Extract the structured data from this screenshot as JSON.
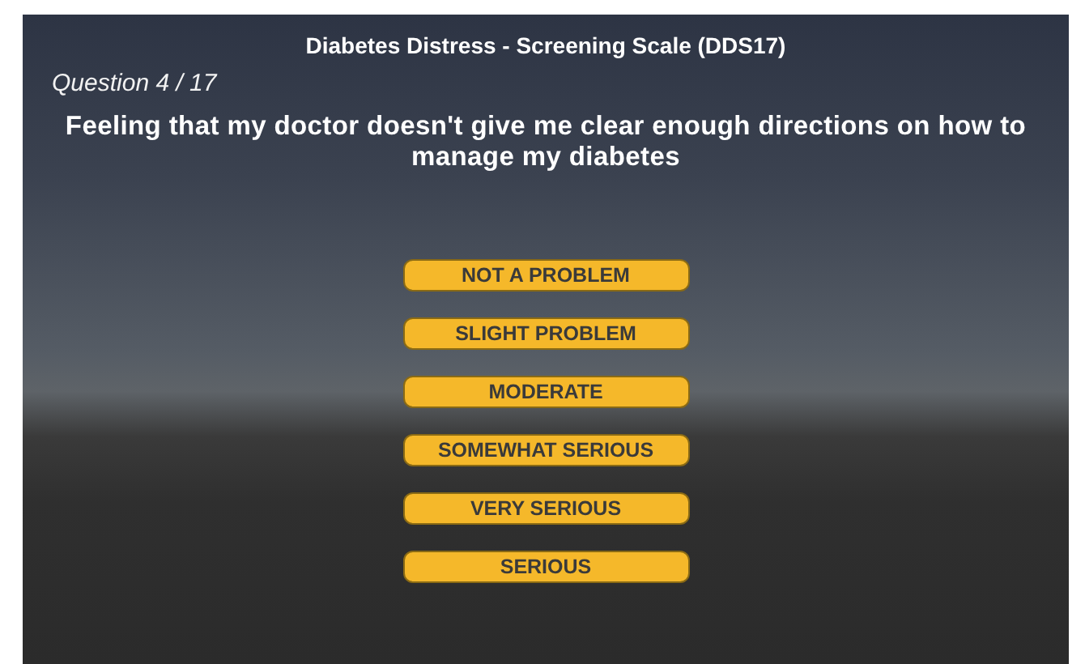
{
  "title": "Diabetes Distress - Screening Scale (DDS17)",
  "progress": "Question 4 / 17",
  "question": "Feeling that my doctor doesn't give me clear enough directions on how to manage my diabetes",
  "answers": [
    {
      "label": "NOT A PROBLEM"
    },
    {
      "label": "SLIGHT PROBLEM"
    },
    {
      "label": "MODERATE"
    },
    {
      "label": "SOMEWHAT SERIOUS"
    },
    {
      "label": "VERY SERIOUS"
    },
    {
      "label": "SERIOUS"
    }
  ]
}
